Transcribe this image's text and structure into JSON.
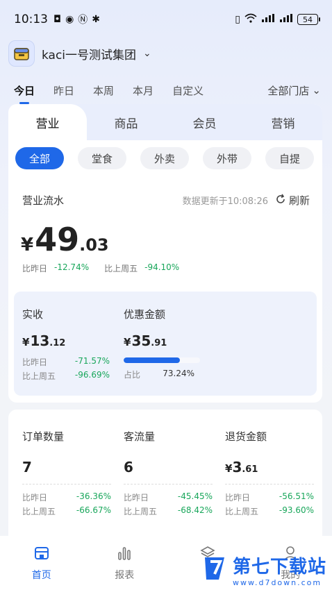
{
  "status_bar": {
    "time": "10:13",
    "battery": "54"
  },
  "org": {
    "name": "kaci一号测试集团"
  },
  "date_tabs": [
    "今日",
    "昨日",
    "本周",
    "本月",
    "自定义"
  ],
  "store_select": "全部门店",
  "category_tabs": [
    "营业",
    "商品",
    "会员",
    "营销"
  ],
  "channel_chips": [
    "全部",
    "堂食",
    "外卖",
    "外带",
    "自提"
  ],
  "revenue": {
    "title": "营业流水",
    "updated": "数据更新于10:08:26",
    "refresh": "刷新",
    "currency": "¥",
    "int": "49",
    "dec": ".03",
    "cmp1_label": "比昨日",
    "cmp1_value": "-12.74%",
    "cmp2_label": "比上周五",
    "cmp2_value": "-94.10%"
  },
  "actual": {
    "label": "实收",
    "currency": "¥",
    "int": "13",
    "dec": ".12",
    "cmp1_label": "比昨日",
    "cmp1_value": "-71.57%",
    "cmp2_label": "比上周五",
    "cmp2_value": "-96.69%"
  },
  "discount": {
    "label": "优惠金额",
    "currency": "¥",
    "int": "35",
    "dec": ".91",
    "ratio_label": "占比",
    "ratio_value": "73.24%",
    "ratio_fraction": 0.7324
  },
  "metrics": [
    {
      "label": "订单数量",
      "currency": "",
      "int": "7",
      "dec": "",
      "cmp1_label": "比昨日",
      "cmp1_value": "-36.36%",
      "cmp2_label": "比上周五",
      "cmp2_value": "-66.67%"
    },
    {
      "label": "客流量",
      "currency": "",
      "int": "6",
      "dec": "",
      "cmp1_label": "比昨日",
      "cmp1_value": "-45.45%",
      "cmp2_label": "比上周五",
      "cmp2_value": "-68.42%"
    },
    {
      "label": "退货金额",
      "currency": "¥",
      "int": "3",
      "dec": ".61",
      "cmp1_label": "比昨日",
      "cmp1_value": "-56.51%",
      "cmp2_label": "比上周五",
      "cmp2_value": "-93.60%"
    }
  ],
  "bottom_nav": [
    {
      "label": "首页",
      "icon": "home-icon"
    },
    {
      "label": "报表",
      "icon": "chart-icon"
    },
    {
      "label": "",
      "icon": "cube-icon"
    },
    {
      "label": "我的",
      "icon": "user-icon"
    }
  ],
  "watermark": {
    "name": "第七下载站",
    "url": "www.d7down.com"
  },
  "colors": {
    "accent": "#1f68e8",
    "positive": "#18a65a"
  }
}
